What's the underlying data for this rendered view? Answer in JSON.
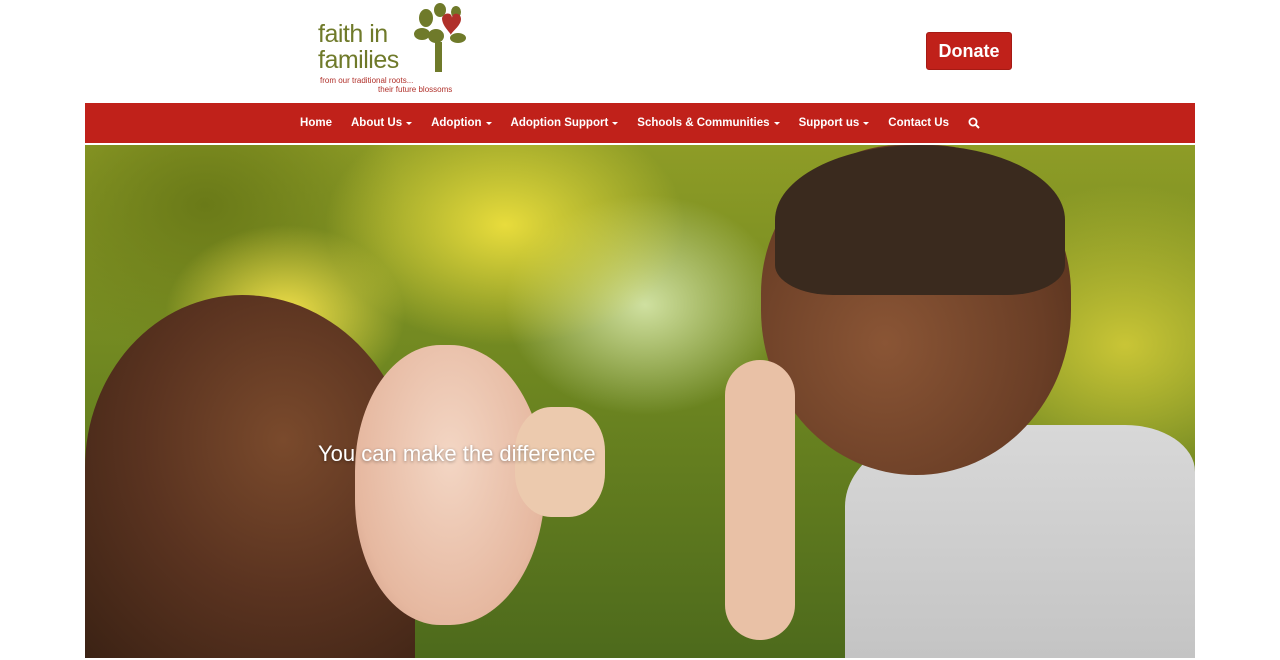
{
  "logo": {
    "line1": "faith in",
    "line2": "families",
    "slogan1": "from our traditional roots...",
    "slogan2": "their future blossoms"
  },
  "header": {
    "donate_label": "Donate"
  },
  "nav": {
    "items": [
      {
        "label": "Home",
        "dropdown": false
      },
      {
        "label": "About Us",
        "dropdown": true
      },
      {
        "label": "Adoption",
        "dropdown": true
      },
      {
        "label": "Adoption Support",
        "dropdown": true
      },
      {
        "label": "Schools & Communities",
        "dropdown": true
      },
      {
        "label": "Support us",
        "dropdown": true
      },
      {
        "label": "Contact Us",
        "dropdown": false
      }
    ],
    "search_icon": "search-icon"
  },
  "hero": {
    "tagline": "You can make the difference"
  },
  "colors": {
    "brand_red": "#c0211a",
    "logo_green": "#6f7a2a"
  }
}
